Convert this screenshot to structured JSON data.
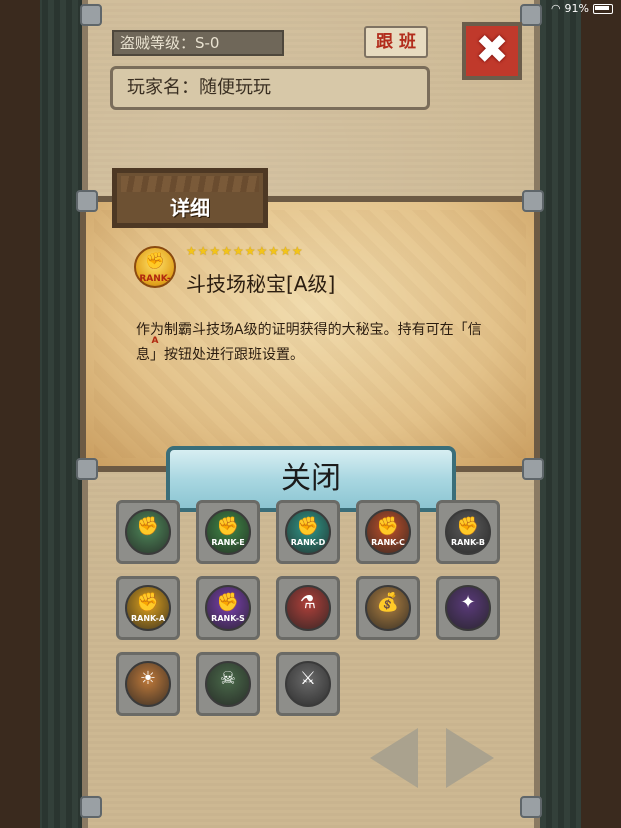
{
  "status_bar": {
    "battery": "91%"
  },
  "header": {
    "bandit_level": "盗贼等级：S-0",
    "follow_button": "跟 班",
    "close_icon": "✖",
    "player_name": "玩家名：随便玩玩"
  },
  "dialog": {
    "tab_title": "详细",
    "badge_label": "RANK-A",
    "stars": "★★★★★★★★★★",
    "item_name": "斗技场秘宝[A级]",
    "description": "作为制霸斗技场A级的证明获得的大秘宝。持有可在「信息」按钮处进行跟班设置。",
    "close_button": "关闭"
  },
  "grid": {
    "items": [
      {
        "label": "",
        "glyph": "✊",
        "color": "#4f8a5a"
      },
      {
        "label": "RANK-E",
        "glyph": "✊",
        "color": "#3f8a46"
      },
      {
        "label": "RANK-D",
        "glyph": "✊",
        "color": "#2f9a8a"
      },
      {
        "label": "RANK-C",
        "glyph": "✊",
        "color": "#c0502a"
      },
      {
        "label": "RANK-B",
        "glyph": "✊",
        "color": "#5b5b5b"
      },
      {
        "label": "RANK-A",
        "glyph": "✊",
        "color": "#e0a21c"
      },
      {
        "label": "RANK-S",
        "glyph": "✊",
        "color": "#7a3fb0"
      },
      {
        "label": "",
        "glyph": "⚗",
        "color": "#b0403a"
      },
      {
        "label": "",
        "glyph": "💰",
        "color": "#b08040"
      },
      {
        "label": "",
        "glyph": "✦",
        "color": "#5a3a7a"
      },
      {
        "label": "",
        "glyph": "☀",
        "color": "#c07a3a"
      },
      {
        "label": "",
        "glyph": "☠",
        "color": "#4a6a4a"
      },
      {
        "label": "",
        "glyph": "⚔",
        "color": "#6a6a6a"
      }
    ]
  }
}
